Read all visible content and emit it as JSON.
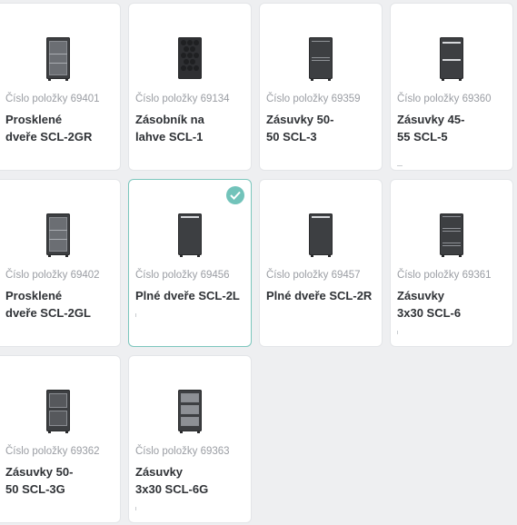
{
  "item_prefix": "Číslo položky",
  "products": [
    {
      "number": "69401",
      "name": "Prosklené\ndveře SCL-2GR",
      "selected": false
    },
    {
      "number": "69134",
      "name": "Zásobník na\nlahve SCL-1",
      "selected": false
    },
    {
      "number": "69359",
      "name": "Zásuvky 50-\n50 SCL-3",
      "selected": false
    },
    {
      "number": "69360",
      "name": "Zásuvky 45-\n55 SCL-5",
      "selected": false
    },
    {
      "number": "69402",
      "name": "Prosklené\ndveře SCL-2GL",
      "selected": false
    },
    {
      "number": "69456",
      "name": "Plné dveře SCL-2L",
      "selected": true
    },
    {
      "number": "69457",
      "name": "Plné dveře SCL-2R",
      "selected": false
    },
    {
      "number": "69361",
      "name": "Zásuvky\n3x30 SCL-6",
      "selected": false
    },
    {
      "number": "69362",
      "name": "Zásuvky 50-\n50 SCL-3G",
      "selected": false
    },
    {
      "number": "69363",
      "name": "Zásuvky\n3x30 SCL-6G",
      "selected": false
    }
  ],
  "colors": {
    "accent": "#72c3ba",
    "selected_border": "#7cc6bd",
    "cabinet": "#3d3f42"
  }
}
